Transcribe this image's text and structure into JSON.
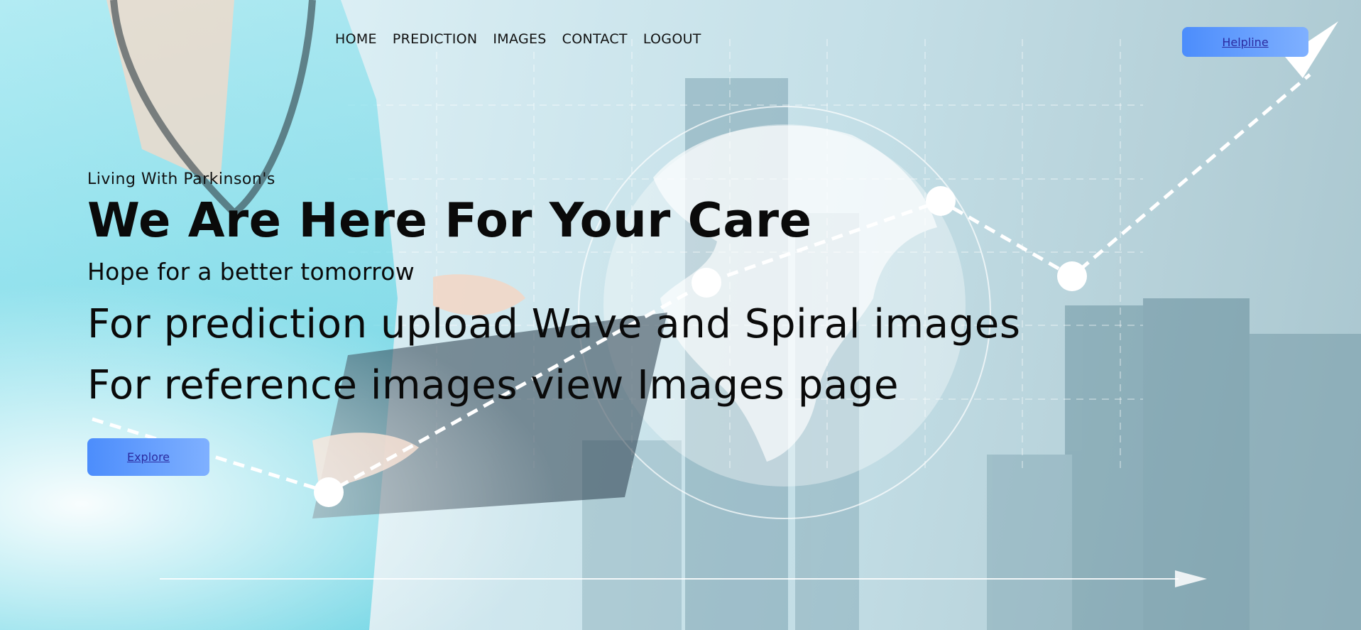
{
  "nav": {
    "items": [
      {
        "label": "HOME"
      },
      {
        "label": "PREDICTION"
      },
      {
        "label": "IMAGES"
      },
      {
        "label": "CONTACT"
      },
      {
        "label": "LOGOUT"
      }
    ],
    "helpline_label": "Helpline"
  },
  "hero": {
    "eyebrow": "Living With Parkinson's",
    "title": "We Are Here For Your Care",
    "subtitle": "Hope for a better tomorrow",
    "line1": "For prediction upload Wave and Spiral images",
    "line2": "For reference images view Images page",
    "explore_label": "Explore"
  },
  "colors": {
    "button_start": "#4c8dfc",
    "button_end": "#7fb0ff",
    "link_text": "#2b2ba0",
    "text": "#0a0a0a"
  }
}
